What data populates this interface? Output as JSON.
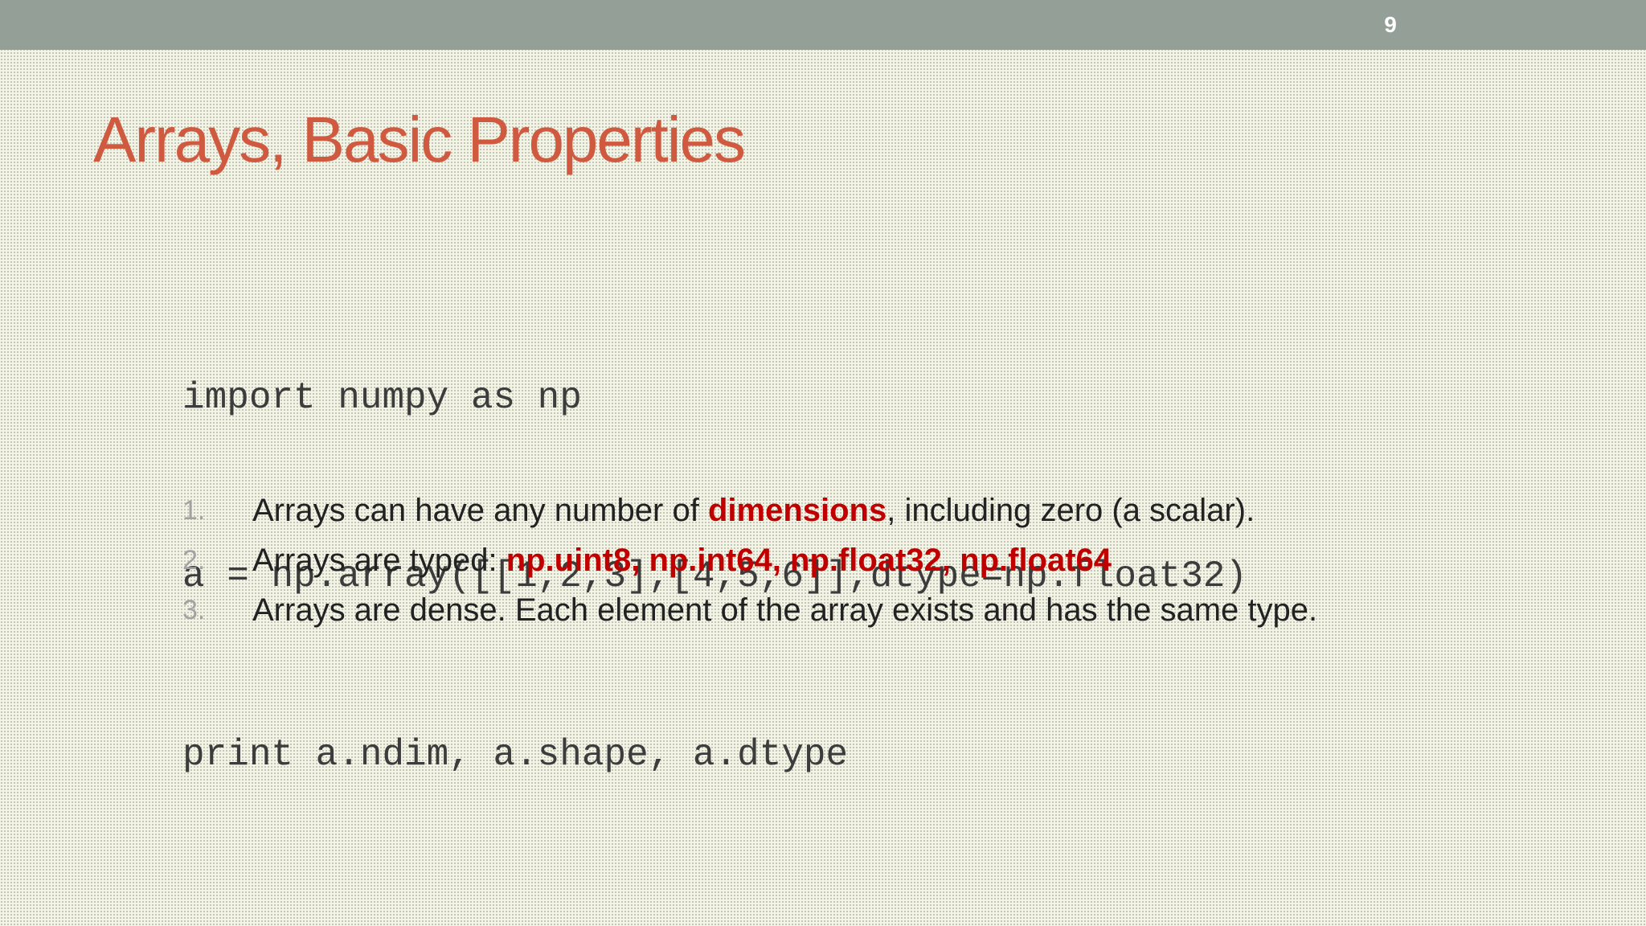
{
  "header": {
    "slide_number": "9",
    "bar_color": "#949f98"
  },
  "slide": {
    "title": "Arrays, Basic Properties",
    "title_color": "#cf5a40",
    "code": [
      "import numpy as np",
      "a = np.array([[1,2,3],[4,5,6]],dtype=np.float32)",
      "print a.ndim, a.shape, a.dtype"
    ],
    "highlight_color": "#c00000",
    "list": [
      {
        "num": "1.",
        "before": "Arrays can have any number of ",
        "highlight": "dimensions",
        "after": ", including zero (a scalar)."
      },
      {
        "num": "2.",
        "before": "Arrays are typed: ",
        "highlight": "np.uint8, np.int64, np.float32, np.float64",
        "after": ""
      },
      {
        "num": "3.",
        "before": "Arrays are dense. Each element of the array exists and has the same type.",
        "highlight": "",
        "after": ""
      }
    ]
  }
}
